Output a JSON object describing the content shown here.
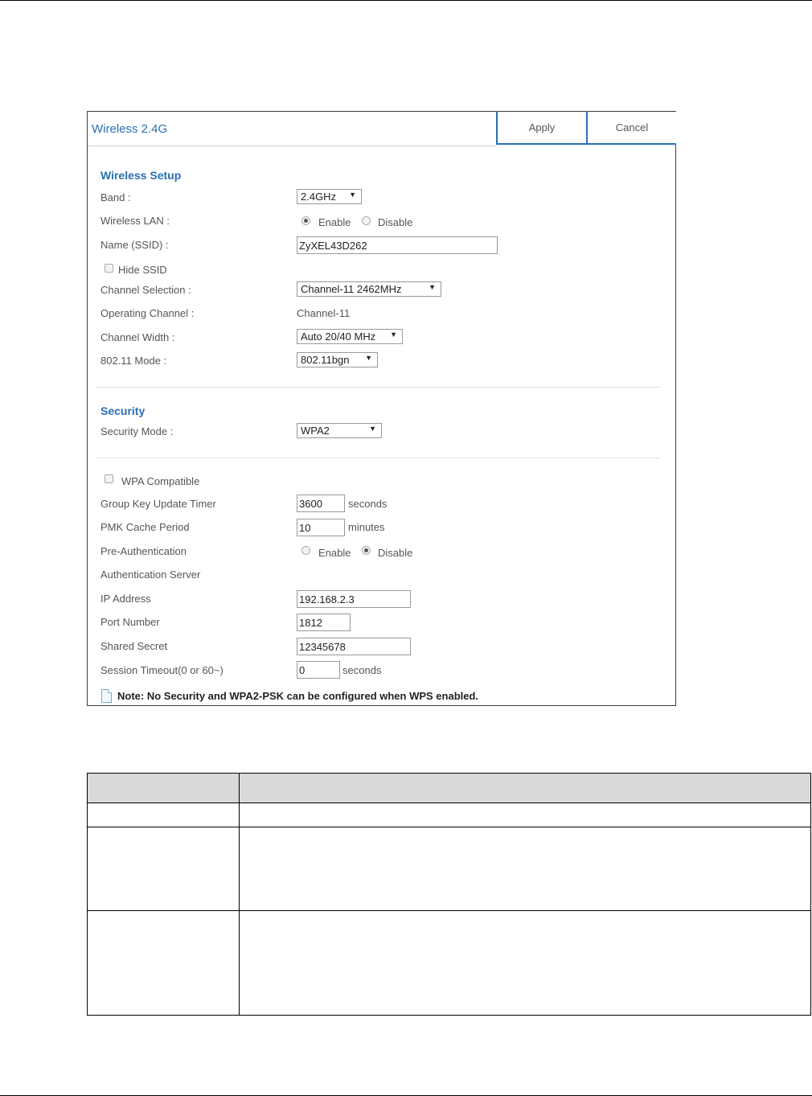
{
  "panel": {
    "title": "Wireless 2.4G",
    "apply_label": "Apply",
    "cancel_label": "Cancel"
  },
  "wireless_setup": {
    "title": "Wireless Setup",
    "band_label": "Band :",
    "band_value": "2.4GHz",
    "wireless_lan_label": "Wireless LAN :",
    "enable_label": "Enable",
    "disable_label": "Disable",
    "wireless_lan_selected": "Enable",
    "name_label": "Name (SSID) :",
    "name_value": "ZyXEL43D262",
    "hide_ssid_label": "Hide SSID",
    "hide_ssid_checked": false,
    "channel_selection_label": "Channel Selection :",
    "channel_selection_value": "Channel-11 2462MHz",
    "operating_channel_label": "Operating Channel :",
    "operating_channel_value": "Channel-11",
    "channel_width_label": "Channel Width :",
    "channel_width_value": "Auto 20/40 MHz",
    "mode_label": "802.11 Mode :",
    "mode_value": "802.11bgn"
  },
  "security": {
    "title": "Security",
    "security_mode_label": "Security Mode :",
    "security_mode_value": "WPA2",
    "wpa_compatible_label": "WPA Compatible",
    "wpa_compatible_checked": false,
    "group_key_label": "Group Key Update Timer",
    "group_key_value": "3600",
    "group_key_unit": "seconds",
    "pmk_label": "PMK Cache Period",
    "pmk_value": "10",
    "pmk_unit": "minutes",
    "preauth_label": "Pre-Authentication",
    "enable_label": "Enable",
    "disable_label": "Disable",
    "preauth_selected": "Disable",
    "auth_server_label": "Authentication Server",
    "ip_label": "IP Address",
    "ip_value": "192.168.2.3",
    "port_label": "Port Number",
    "port_value": "1812",
    "secret_label": "Shared Secret",
    "secret_value": "12345678",
    "session_label": "Session Timeout(0 or 60~)",
    "session_value": "0",
    "session_unit": "seconds"
  },
  "note": "Note: No Security and WPA2-PSK can be configured when WPS enabled.",
  "colors": {
    "accent": "#2a6fb6",
    "table_header": "#d9d9d9"
  }
}
